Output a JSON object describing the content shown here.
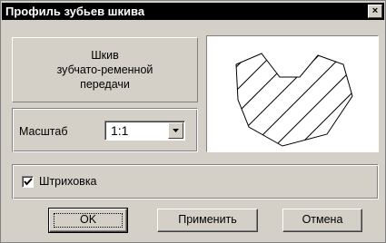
{
  "window": {
    "title": "Профиль зубьев шкива",
    "close_label": "×"
  },
  "info": {
    "line1": "Шкив",
    "line2": "зубчато-ременной",
    "line3": "передачи"
  },
  "scale": {
    "label": "Масштаб",
    "selected": "1:1"
  },
  "hatching": {
    "label": "Штриховка",
    "checked": true
  },
  "buttons": {
    "ok": "OK",
    "apply": "Применить",
    "cancel": "Отмена"
  },
  "colors": {
    "face": "#d4d0c8",
    "titlebar": "#000000",
    "preview_bg": "#ffffff"
  }
}
